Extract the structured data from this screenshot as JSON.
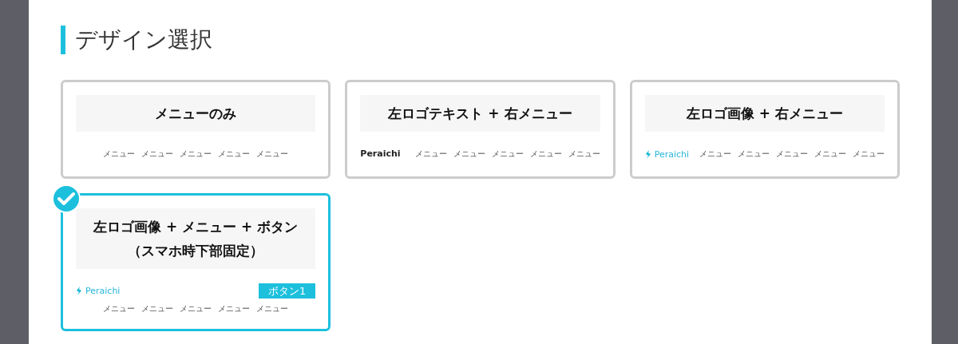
{
  "section_title": "デザイン選択",
  "designs": [
    {
      "kind": "menu_only",
      "name": "メニューのみ",
      "selected": false,
      "menu": [
        "メニュー",
        "メニュー",
        "メニュー",
        "メニュー",
        "メニュー"
      ]
    },
    {
      "kind": "logo_text",
      "name": "左ロゴテキスト + 右メニュー",
      "selected": false,
      "logo": "Peraichi",
      "menu": [
        "メニュー",
        "メニュー",
        "メニュー",
        "メニュー",
        "メニュー"
      ]
    },
    {
      "kind": "logo_image",
      "name": "左ロゴ画像 + 右メニュー",
      "selected": false,
      "logo": "Peraichi",
      "menu": [
        "メニュー",
        "メニュー",
        "メニュー",
        "メニュー",
        "メニュー"
      ]
    },
    {
      "kind": "logo_image_button",
      "name": "左ロゴ画像 + メニュー + ボタン",
      "subtitle": "（スマホ時下部固定）",
      "selected": true,
      "logo": "Peraichi",
      "button": "ボタン1",
      "menu": [
        "メニュー",
        "メニュー",
        "メニュー",
        "メニュー",
        "メニュー"
      ]
    }
  ]
}
